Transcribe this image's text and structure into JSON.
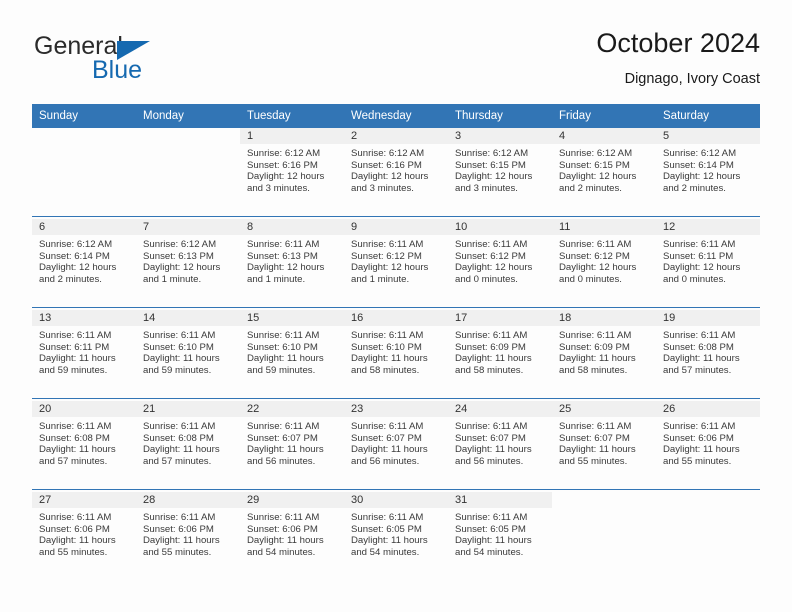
{
  "brand": {
    "name_top": "General",
    "name_bottom": "Blue",
    "accent_color": "#1569b0"
  },
  "header": {
    "title": "October 2024",
    "subtitle": "Dignago, Ivory Coast",
    "header_bg_color": "#3275b5",
    "header_text_color": "#ffffff"
  },
  "calendar": {
    "weekday_headers": [
      "Sunday",
      "Monday",
      "Tuesday",
      "Wednesday",
      "Thursday",
      "Friday",
      "Saturday"
    ],
    "weeks": [
      [
        {
          "day": "",
          "sunrise": "",
          "sunset": "",
          "daylight": "",
          "empty": true
        },
        {
          "day": "",
          "sunrise": "",
          "sunset": "",
          "daylight": "",
          "empty": true
        },
        {
          "day": "1",
          "sunrise": "Sunrise: 6:12 AM",
          "sunset": "Sunset: 6:16 PM",
          "daylight": "Daylight: 12 hours and 3 minutes."
        },
        {
          "day": "2",
          "sunrise": "Sunrise: 6:12 AM",
          "sunset": "Sunset: 6:16 PM",
          "daylight": "Daylight: 12 hours and 3 minutes."
        },
        {
          "day": "3",
          "sunrise": "Sunrise: 6:12 AM",
          "sunset": "Sunset: 6:15 PM",
          "daylight": "Daylight: 12 hours and 3 minutes."
        },
        {
          "day": "4",
          "sunrise": "Sunrise: 6:12 AM",
          "sunset": "Sunset: 6:15 PM",
          "daylight": "Daylight: 12 hours and 2 minutes."
        },
        {
          "day": "5",
          "sunrise": "Sunrise: 6:12 AM",
          "sunset": "Sunset: 6:14 PM",
          "daylight": "Daylight: 12 hours and 2 minutes."
        }
      ],
      [
        {
          "day": "6",
          "sunrise": "Sunrise: 6:12 AM",
          "sunset": "Sunset: 6:14 PM",
          "daylight": "Daylight: 12 hours and 2 minutes."
        },
        {
          "day": "7",
          "sunrise": "Sunrise: 6:12 AM",
          "sunset": "Sunset: 6:13 PM",
          "daylight": "Daylight: 12 hours and 1 minute."
        },
        {
          "day": "8",
          "sunrise": "Sunrise: 6:11 AM",
          "sunset": "Sunset: 6:13 PM",
          "daylight": "Daylight: 12 hours and 1 minute."
        },
        {
          "day": "9",
          "sunrise": "Sunrise: 6:11 AM",
          "sunset": "Sunset: 6:12 PM",
          "daylight": "Daylight: 12 hours and 1 minute."
        },
        {
          "day": "10",
          "sunrise": "Sunrise: 6:11 AM",
          "sunset": "Sunset: 6:12 PM",
          "daylight": "Daylight: 12 hours and 0 minutes."
        },
        {
          "day": "11",
          "sunrise": "Sunrise: 6:11 AM",
          "sunset": "Sunset: 6:12 PM",
          "daylight": "Daylight: 12 hours and 0 minutes."
        },
        {
          "day": "12",
          "sunrise": "Sunrise: 6:11 AM",
          "sunset": "Sunset: 6:11 PM",
          "daylight": "Daylight: 12 hours and 0 minutes."
        }
      ],
      [
        {
          "day": "13",
          "sunrise": "Sunrise: 6:11 AM",
          "sunset": "Sunset: 6:11 PM",
          "daylight": "Daylight: 11 hours and 59 minutes."
        },
        {
          "day": "14",
          "sunrise": "Sunrise: 6:11 AM",
          "sunset": "Sunset: 6:10 PM",
          "daylight": "Daylight: 11 hours and 59 minutes."
        },
        {
          "day": "15",
          "sunrise": "Sunrise: 6:11 AM",
          "sunset": "Sunset: 6:10 PM",
          "daylight": "Daylight: 11 hours and 59 minutes."
        },
        {
          "day": "16",
          "sunrise": "Sunrise: 6:11 AM",
          "sunset": "Sunset: 6:10 PM",
          "daylight": "Daylight: 11 hours and 58 minutes."
        },
        {
          "day": "17",
          "sunrise": "Sunrise: 6:11 AM",
          "sunset": "Sunset: 6:09 PM",
          "daylight": "Daylight: 11 hours and 58 minutes."
        },
        {
          "day": "18",
          "sunrise": "Sunrise: 6:11 AM",
          "sunset": "Sunset: 6:09 PM",
          "daylight": "Daylight: 11 hours and 58 minutes."
        },
        {
          "day": "19",
          "sunrise": "Sunrise: 6:11 AM",
          "sunset": "Sunset: 6:08 PM",
          "daylight": "Daylight: 11 hours and 57 minutes."
        }
      ],
      [
        {
          "day": "20",
          "sunrise": "Sunrise: 6:11 AM",
          "sunset": "Sunset: 6:08 PM",
          "daylight": "Daylight: 11 hours and 57 minutes."
        },
        {
          "day": "21",
          "sunrise": "Sunrise: 6:11 AM",
          "sunset": "Sunset: 6:08 PM",
          "daylight": "Daylight: 11 hours and 57 minutes."
        },
        {
          "day": "22",
          "sunrise": "Sunrise: 6:11 AM",
          "sunset": "Sunset: 6:07 PM",
          "daylight": "Daylight: 11 hours and 56 minutes."
        },
        {
          "day": "23",
          "sunrise": "Sunrise: 6:11 AM",
          "sunset": "Sunset: 6:07 PM",
          "daylight": "Daylight: 11 hours and 56 minutes."
        },
        {
          "day": "24",
          "sunrise": "Sunrise: 6:11 AM",
          "sunset": "Sunset: 6:07 PM",
          "daylight": "Daylight: 11 hours and 56 minutes."
        },
        {
          "day": "25",
          "sunrise": "Sunrise: 6:11 AM",
          "sunset": "Sunset: 6:07 PM",
          "daylight": "Daylight: 11 hours and 55 minutes."
        },
        {
          "day": "26",
          "sunrise": "Sunrise: 6:11 AM",
          "sunset": "Sunset: 6:06 PM",
          "daylight": "Daylight: 11 hours and 55 minutes."
        }
      ],
      [
        {
          "day": "27",
          "sunrise": "Sunrise: 6:11 AM",
          "sunset": "Sunset: 6:06 PM",
          "daylight": "Daylight: 11 hours and 55 minutes."
        },
        {
          "day": "28",
          "sunrise": "Sunrise: 6:11 AM",
          "sunset": "Sunset: 6:06 PM",
          "daylight": "Daylight: 11 hours and 55 minutes."
        },
        {
          "day": "29",
          "sunrise": "Sunrise: 6:11 AM",
          "sunset": "Sunset: 6:06 PM",
          "daylight": "Daylight: 11 hours and 54 minutes."
        },
        {
          "day": "30",
          "sunrise": "Sunrise: 6:11 AM",
          "sunset": "Sunset: 6:05 PM",
          "daylight": "Daylight: 11 hours and 54 minutes."
        },
        {
          "day": "31",
          "sunrise": "Sunrise: 6:11 AM",
          "sunset": "Sunset: 6:05 PM",
          "daylight": "Daylight: 11 hours and 54 minutes."
        },
        {
          "day": "",
          "sunrise": "",
          "sunset": "",
          "daylight": "",
          "empty": true
        },
        {
          "day": "",
          "sunrise": "",
          "sunset": "",
          "daylight": "",
          "empty": true
        }
      ]
    ]
  }
}
